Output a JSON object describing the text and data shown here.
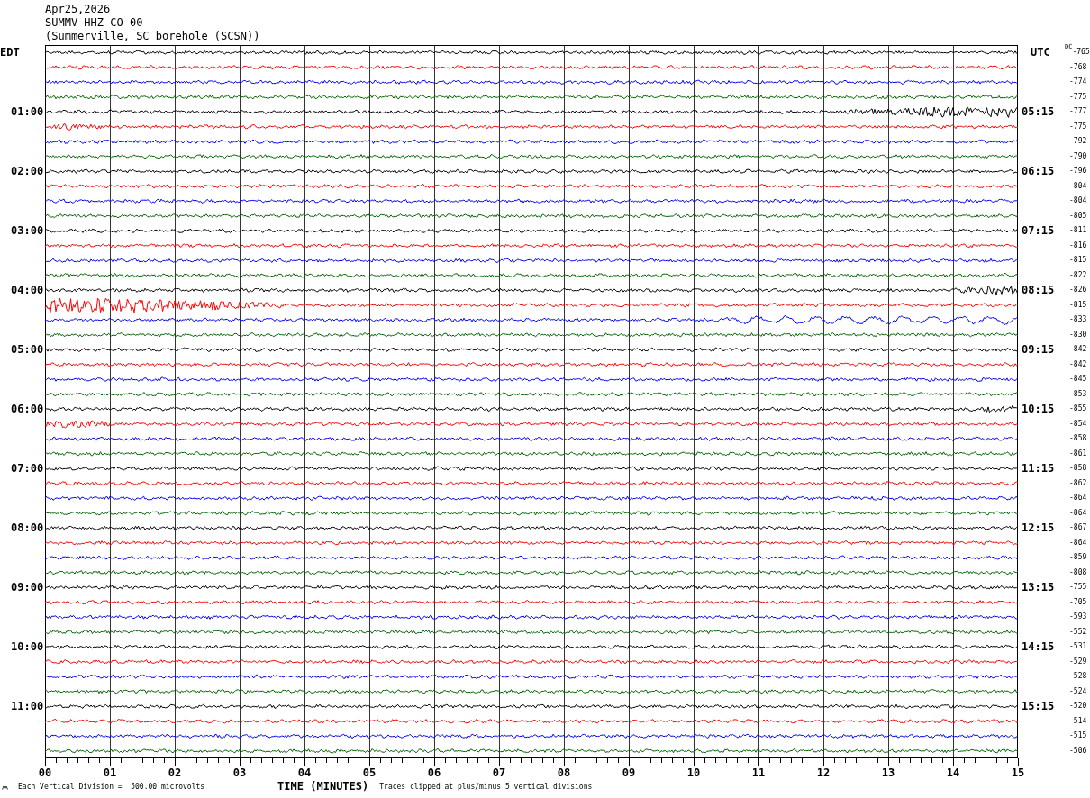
{
  "header": [
    "Apr25,2026",
    "SUMMV HHZ CO 00",
    "(Summerville, SC borehole (SCSN))"
  ],
  "left_title": "EDT",
  "right_title": "UTC",
  "dc_title": "DC",
  "rows": [
    {
      "color": "#000000",
      "dc": "-765"
    },
    {
      "color": "#ff0000",
      "dc": "-768"
    },
    {
      "color": "#0000ff",
      "dc": "-774"
    },
    {
      "color": "#006400",
      "dc": "-775"
    },
    {
      "color": "#000000",
      "left_label": "01:00",
      "right_label": "05:15",
      "dc": "-777"
    },
    {
      "color": "#ff0000",
      "dc": "-775"
    },
    {
      "color": "#0000ff",
      "dc": "-792"
    },
    {
      "color": "#006400",
      "dc": "-790"
    },
    {
      "color": "#000000",
      "left_label": "02:00",
      "right_label": "06:15",
      "dc": "-796"
    },
    {
      "color": "#ff0000",
      "dc": "-804"
    },
    {
      "color": "#0000ff",
      "dc": "-804"
    },
    {
      "color": "#006400",
      "dc": "-805"
    },
    {
      "color": "#000000",
      "left_label": "03:00",
      "right_label": "07:15",
      "dc": "-811"
    },
    {
      "color": "#ff0000",
      "dc": "-816"
    },
    {
      "color": "#0000ff",
      "dc": "-815"
    },
    {
      "color": "#006400",
      "dc": "-822"
    },
    {
      "color": "#000000",
      "left_label": "04:00",
      "right_label": "08:15",
      "dc": "-826"
    },
    {
      "color": "#ff0000",
      "dc": "-815"
    },
    {
      "color": "#0000ff",
      "dc": "-833"
    },
    {
      "color": "#006400",
      "dc": "-830"
    },
    {
      "color": "#000000",
      "left_label": "05:00",
      "right_label": "09:15",
      "dc": "-842"
    },
    {
      "color": "#ff0000",
      "dc": "-842"
    },
    {
      "color": "#0000ff",
      "dc": "-845"
    },
    {
      "color": "#006400",
      "dc": "-853"
    },
    {
      "color": "#000000",
      "left_label": "06:00",
      "right_label": "10:15",
      "dc": "-855"
    },
    {
      "color": "#ff0000",
      "dc": "-854"
    },
    {
      "color": "#0000ff",
      "dc": "-858"
    },
    {
      "color": "#006400",
      "dc": "-861"
    },
    {
      "color": "#000000",
      "left_label": "07:00",
      "right_label": "11:15",
      "dc": "-858"
    },
    {
      "color": "#ff0000",
      "dc": "-862"
    },
    {
      "color": "#0000ff",
      "dc": "-864"
    },
    {
      "color": "#006400",
      "dc": "-864"
    },
    {
      "color": "#000000",
      "left_label": "08:00",
      "right_label": "12:15",
      "dc": "-867"
    },
    {
      "color": "#ff0000",
      "dc": "-864"
    },
    {
      "color": "#0000ff",
      "dc": "-859"
    },
    {
      "color": "#006400",
      "dc": "-808"
    },
    {
      "color": "#000000",
      "left_label": "09:00",
      "right_label": "13:15",
      "dc": "-755"
    },
    {
      "color": "#ff0000",
      "dc": "-705"
    },
    {
      "color": "#0000ff",
      "dc": "-593"
    },
    {
      "color": "#006400",
      "dc": "-552"
    },
    {
      "color": "#000000",
      "left_label": "10:00",
      "right_label": "14:15",
      "dc": "-531"
    },
    {
      "color": "#ff0000",
      "dc": "-529"
    },
    {
      "color": "#0000ff",
      "dc": "-528"
    },
    {
      "color": "#006400",
      "dc": "-524"
    },
    {
      "color": "#000000",
      "left_label": "11:00",
      "right_label": "15:15",
      "dc": "-520"
    },
    {
      "color": "#ff0000",
      "dc": "-514"
    },
    {
      "color": "#0000ff",
      "dc": "-515"
    },
    {
      "color": "#006400",
      "dc": "-506"
    }
  ],
  "x_ticks": [
    "00",
    "01",
    "02",
    "03",
    "04",
    "05",
    "06",
    "07",
    "08",
    "09",
    "10",
    "11",
    "12",
    "13",
    "14",
    "15"
  ],
  "xlabel": "TIME (MINUTES)",
  "scale_note": "Each Vertical Division =  500.00 microvolts",
  "clip_note": "Traces clipped at plus/minus 5 vertical divisions"
}
